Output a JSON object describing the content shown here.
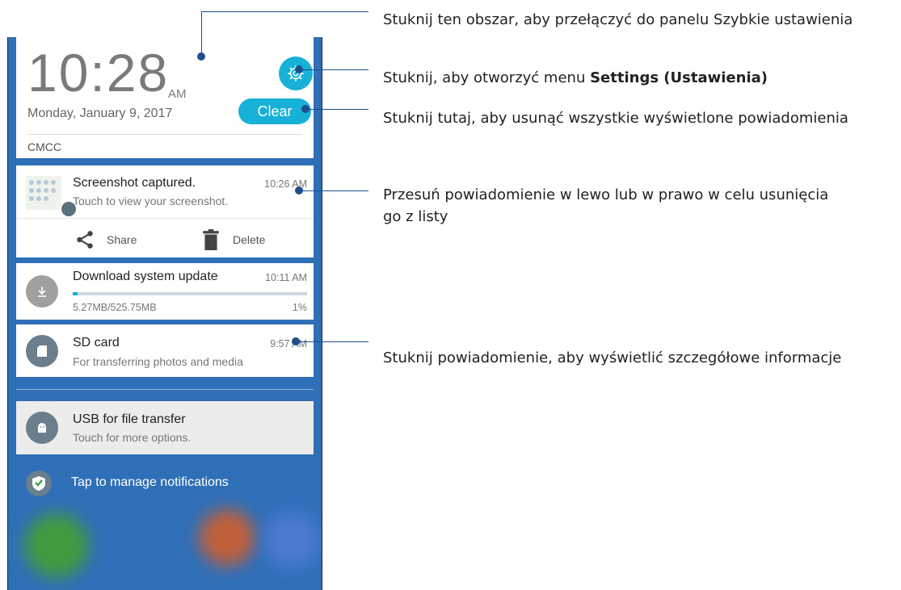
{
  "header": {
    "time": "10:28",
    "ampm": "AM",
    "date": "Monday, January 9, 2017",
    "clear_label": "Clear",
    "carrier": "CMCC"
  },
  "notifications": {
    "screenshot": {
      "title": "Screenshot captured.",
      "subtitle": "Touch to view your screenshot.",
      "time": "10:26 AM",
      "share_label": "Share",
      "delete_label": "Delete"
    },
    "download": {
      "title": "Download system update",
      "time": "10:11 AM",
      "size": "5.27MB/525.75MB",
      "percent": "1%",
      "progress": 0.01
    },
    "sdcard": {
      "title": "SD card",
      "subtitle": "For transferring photos and media",
      "time": "9:57 AM"
    },
    "usb": {
      "title": "USB for file transfer",
      "subtitle": "Touch for more options."
    },
    "manage_label": "Tap to manage notifications"
  },
  "callouts": {
    "quick_settings": "Stuknij ten obszar, aby przełączyć do panelu Szybkie ustawienia",
    "settings_prefix": "Stuknij, aby otworzyć menu ",
    "settings_bold": "Settings (Ustawienia)",
    "clear": "Stuknij tutaj, aby usunąć wszystkie wyświetlone powiadomienia",
    "swipe_line1": "Przesuń powiadomienie w lewo lub w prawo w celu usunięcia",
    "swipe_line2": "go z listy",
    "details": "Stuknij powiadomienie, aby wyświetlić szczegółowe informacje"
  },
  "colors": {
    "accent": "#17b1d8",
    "callout_line": "#1f4e8c"
  },
  "icons": [
    "gear-icon",
    "share-icon",
    "trash-icon",
    "download-icon",
    "sd-card-icon",
    "android-icon",
    "shield-icon"
  ]
}
